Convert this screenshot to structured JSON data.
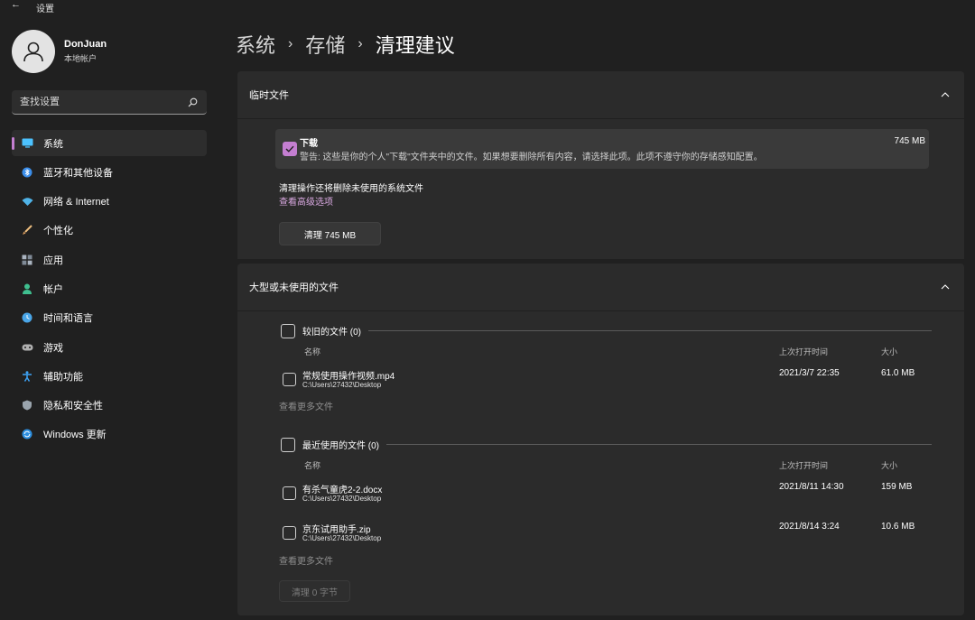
{
  "window": {
    "back_icon": "←",
    "title": "设置"
  },
  "profile": {
    "name": "DonJuan",
    "account_type": "本地帐户"
  },
  "search": {
    "placeholder": "查找设置"
  },
  "sidebar": {
    "items": [
      {
        "label": "系统",
        "icon": "monitor-icon",
        "color": "#4cc2ff",
        "active": true
      },
      {
        "label": "蓝牙和其他设备",
        "icon": "bluetooth-icon",
        "color": "#3b8eea"
      },
      {
        "label": "网络 & Internet",
        "icon": "wifi-icon",
        "color": "#4fb3e8"
      },
      {
        "label": "个性化",
        "icon": "brush-icon",
        "color": "#e0a060"
      },
      {
        "label": "应用",
        "icon": "apps-icon",
        "color": "#aab4c0"
      },
      {
        "label": "帐户",
        "icon": "person-icon",
        "color": "#3fbf8f"
      },
      {
        "label": "时间和语言",
        "icon": "globe-clock-icon",
        "color": "#4aa6e8"
      },
      {
        "label": "游戏",
        "icon": "gamepad-icon",
        "color": "#b0b0b0"
      },
      {
        "label": "辅助功能",
        "icon": "accessibility-icon",
        "color": "#3da3f5"
      },
      {
        "label": "隐私和安全性",
        "icon": "shield-icon",
        "color": "#9aa4ad"
      },
      {
        "label": "Windows 更新",
        "icon": "update-icon",
        "color": "#2d8fe0"
      }
    ]
  },
  "breadcrumb": {
    "level1": "系统",
    "level2": "存储",
    "current": "清理建议",
    "separator": "›"
  },
  "temp_files": {
    "header": "临时文件",
    "downloads": {
      "title": "下载",
      "description": "警告: 这些是你的个人\"下载\"文件夹中的文件。如果想要删除所有内容，请选择此项。此项不遵守你的存储感知配置。",
      "size": "745 MB",
      "checked": true
    },
    "note": "清理操作还将删除未使用的系统文件",
    "advanced_link": "查看高级选项",
    "clean_button": "清理 745 MB"
  },
  "large_files": {
    "header": "大型或未使用的文件",
    "columns": {
      "name": "名称",
      "last_opened": "上次打开时间",
      "size": "大小"
    },
    "older": {
      "title": "较旧的文件 (0)",
      "files": [
        {
          "name": "常规使用操作视频.mp4",
          "path": "C:\\Users\\27432\\Desktop",
          "date": "2021/3/7 22:35",
          "size": "61.0 MB"
        }
      ],
      "more": "查看更多文件"
    },
    "recent": {
      "title": "最近使用的文件 (0)",
      "files": [
        {
          "name": "有杀气童虎2-2.docx",
          "path": "C:\\Users\\27432\\Desktop",
          "date": "2021/8/11 14:30",
          "size": "159 MB"
        },
        {
          "name": "京东试用助手.zip",
          "path": "C:\\Users\\27432\\Desktop",
          "date": "2021/8/14 3:24",
          "size": "10.6 MB"
        }
      ],
      "more": "查看更多文件"
    },
    "clean_button": "清理 0 字节"
  },
  "colors": {
    "accent": "#c47ed1",
    "background": "#202020",
    "card": "#2b2b2b"
  }
}
